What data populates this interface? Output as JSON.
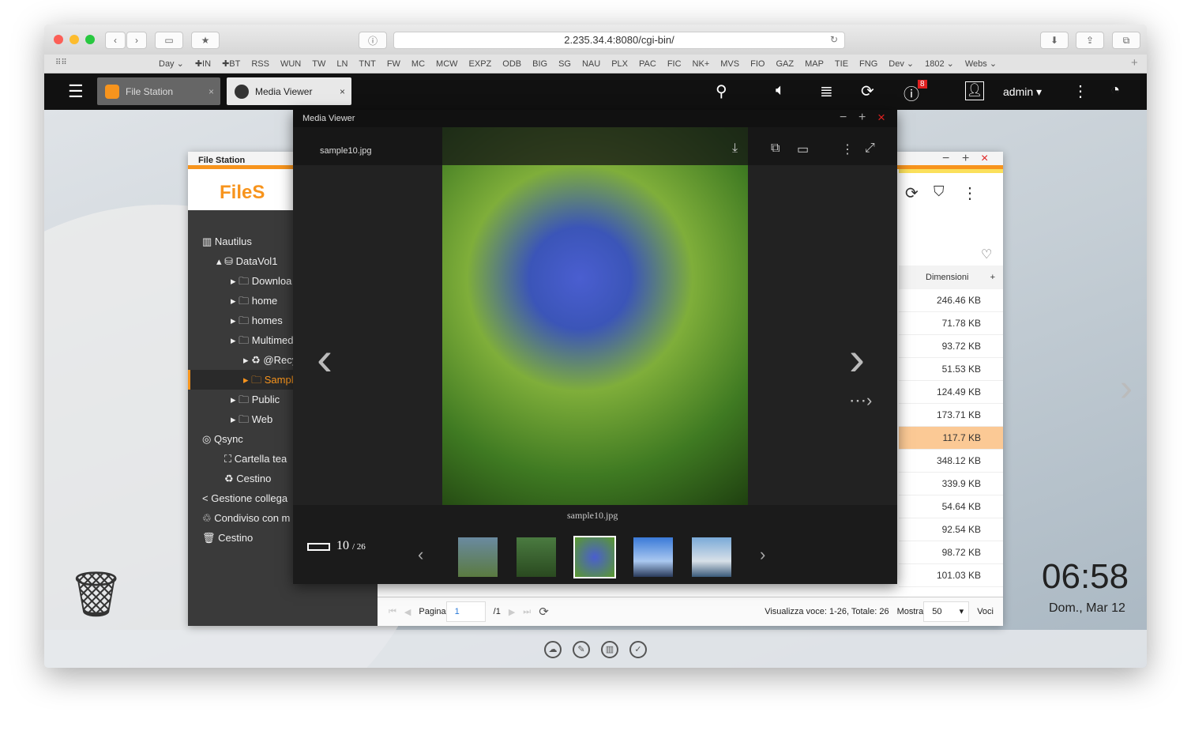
{
  "browser": {
    "url": "2.235.34.4:8080/cgi-bin/",
    "bookmarks": [
      "Day ⌄",
      "✚IN",
      "✚BT",
      "RSS",
      "WUN",
      "TW",
      "LN",
      "TNT",
      "FW",
      "MC",
      "MCW",
      "EXPZ",
      "ODB",
      "BIG",
      "SG",
      "NAU",
      "PLX",
      "PAC",
      "FIC",
      "NK+",
      "MVS",
      "FIO",
      "GAZ",
      "MAP",
      "TIE",
      "FNG",
      "Dev ⌄",
      "1802 ⌄",
      "Webs ⌄"
    ]
  },
  "qts": {
    "tabs": [
      {
        "label": "File Station"
      },
      {
        "label": "Media Viewer"
      }
    ],
    "user": "admin ▾",
    "notif_count": "8"
  },
  "file_station": {
    "title": "File Station",
    "logo": "FileS",
    "tree": [
      {
        "label": "Nautilus",
        "icon": "server"
      },
      {
        "label": "DataVol1",
        "icon": "drive"
      },
      {
        "label": "Downloa"
      },
      {
        "label": "home"
      },
      {
        "label": "homes"
      },
      {
        "label": "Multimed"
      },
      {
        "label": "@Recy"
      },
      {
        "label": "Sampl"
      },
      {
        "label": "Public"
      },
      {
        "label": "Web"
      },
      {
        "label": "Qsync"
      },
      {
        "label": "Cartella tea"
      },
      {
        "label": "Cestino"
      },
      {
        "label": "Gestione collega"
      },
      {
        "label": "Condiviso con m"
      },
      {
        "label": "Cestino"
      }
    ],
    "column_header": "Dimensioni",
    "sizes": [
      "246.46 KB",
      "71.78 KB",
      "93.72 KB",
      "51.53 KB",
      "124.49 KB",
      "173.71 KB",
      "117.7 KB",
      "348.12 KB",
      "339.9 KB",
      "54.64 KB",
      "92.54 KB",
      "98.72 KB",
      "101.03 KB"
    ],
    "pager": {
      "page_label": "Pagina",
      "page_value": "1",
      "page_total": "/1",
      "summary": "Visualizza voce: 1-26, Totale: 26",
      "show_label": "Mostra",
      "show_value": "50",
      "items_label": "Voci"
    }
  },
  "media_viewer": {
    "title": "Media Viewer",
    "filename": "sample10.jpg",
    "caption": "sample10.jpg",
    "counter": "10",
    "counter_total": "/ 26"
  },
  "clock": {
    "time": "06:58",
    "date": "Dom., Mar 12"
  },
  "colors": {
    "accent": "#f7941d",
    "selected_row": "#fbc995",
    "close": "#e02020"
  }
}
